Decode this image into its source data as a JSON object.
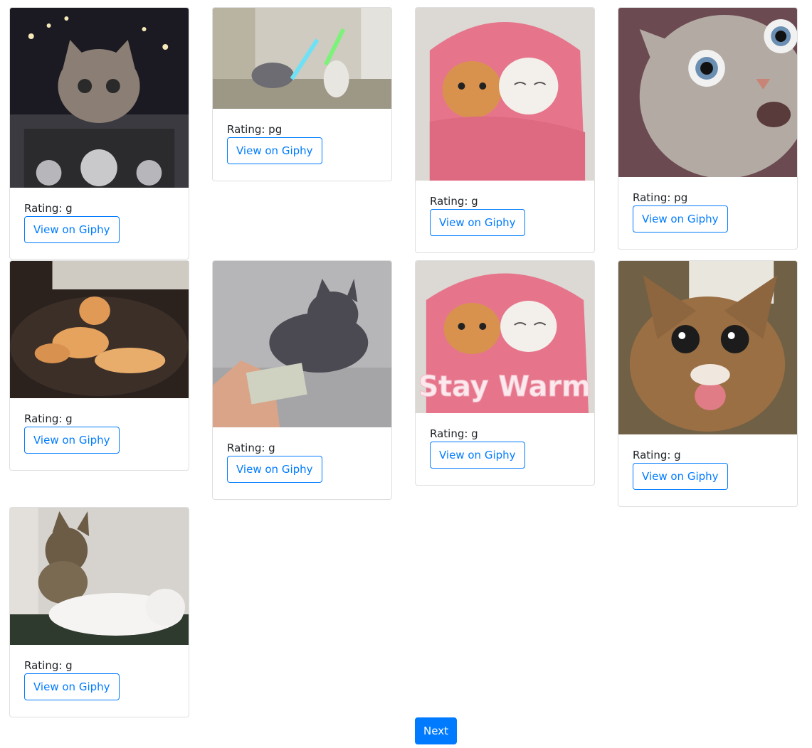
{
  "cards": [
    {
      "rating": "Rating: g",
      "link_label": "View on Giphy",
      "image": "cat-riding-motorcycle-gif"
    },
    {
      "rating": "Rating: pg",
      "link_label": "View on Giphy",
      "image": "cats-lightsaber-duel-gif"
    },
    {
      "rating": "Rating: g",
      "link_label": "View on Giphy",
      "image": "two-cats-in-pink-blanket-gif"
    },
    {
      "rating": "Rating: pg",
      "link_label": "View on Giphy",
      "image": "surprised-wide-eyed-cat-gif"
    },
    {
      "rating": "Rating: g",
      "link_label": "View on Giphy",
      "image": "cat-kneading-cat-on-sofa-gif"
    },
    {
      "rating": "Rating: g",
      "link_label": "View on Giphy",
      "image": "cat-grabbing-money-gif"
    },
    {
      "rating": "Rating: g",
      "link_label": "View on Giphy",
      "image": "cats-in-blanket-stay-warm-gif",
      "caption": "Stay Warm"
    },
    {
      "rating": "Rating: g",
      "link_label": "View on Giphy",
      "image": "excited-cat-tongue-out-gif"
    },
    {
      "rating": "Rating: g",
      "link_label": "View on Giphy",
      "image": "kitten-massaging-cat-gif"
    }
  ],
  "pagination": {
    "next_label": "Next"
  },
  "colors": {
    "primary": "#007bff",
    "border": "#dfdfdf"
  }
}
